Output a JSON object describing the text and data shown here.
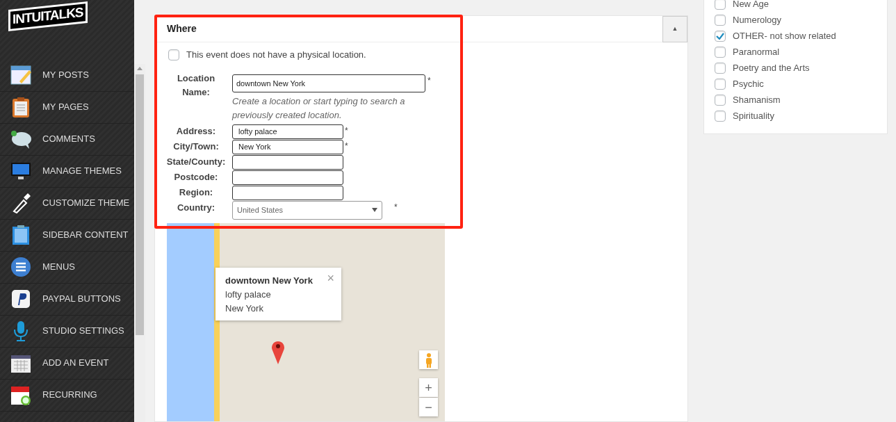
{
  "sidebar": {
    "logo": "INTUITALKS",
    "items": [
      {
        "label": "MY POSTS"
      },
      {
        "label": "MY PAGES"
      },
      {
        "label": "COMMENTS"
      },
      {
        "label": "MANAGE THEMES"
      },
      {
        "label": "CUSTOMIZE THEME"
      },
      {
        "label": "SIDEBAR CONTENT"
      },
      {
        "label": "MENUS"
      },
      {
        "label": "PAYPAL BUTTONS"
      },
      {
        "label": "STUDIO SETTINGS"
      },
      {
        "label": "ADD AN EVENT"
      },
      {
        "label": "RECURRING"
      }
    ]
  },
  "where_panel": {
    "title": "Where",
    "toggle": "▲",
    "no_location": {
      "label": "This event does not have a physical location.",
      "checked": false
    },
    "fields": [
      {
        "label": "Location Name:",
        "value": "downtown New York",
        "mark": "*",
        "kind": "wide",
        "hint": "Create a location or start typing to search a previously created location."
      },
      {
        "label": "Address:",
        "value": "lofty palace",
        "mark": "*",
        "kind": "text"
      },
      {
        "label": "City/Town:",
        "value": "New York",
        "mark": "*",
        "kind": "text"
      },
      {
        "label": "State/County:",
        "kind": "text"
      },
      {
        "label": "Postcode:",
        "kind": "text"
      },
      {
        "label": "Region:",
        "kind": "text"
      },
      {
        "label": "Country:",
        "value": "United States",
        "mark": "*",
        "kind": "select"
      }
    ],
    "map": {
      "info_window": {
        "title": "downtown New York",
        "lines": [
          "lofty  palace",
          "New York"
        ],
        "close": "×"
      },
      "zoom_in": "+",
      "zoom_out": "−"
    }
  },
  "categories": [
    {
      "label": "New Age",
      "checked": false
    },
    {
      "label": "Numerology",
      "checked": false
    },
    {
      "label": "OTHER- not show related",
      "checked": true
    },
    {
      "label": "Paranormal",
      "checked": false
    },
    {
      "label": "Poetry and the Arts",
      "checked": false
    },
    {
      "label": "Psychic",
      "checked": false
    },
    {
      "label": "Shamanism",
      "checked": false
    },
    {
      "label": "Spirituality",
      "checked": false
    }
  ]
}
